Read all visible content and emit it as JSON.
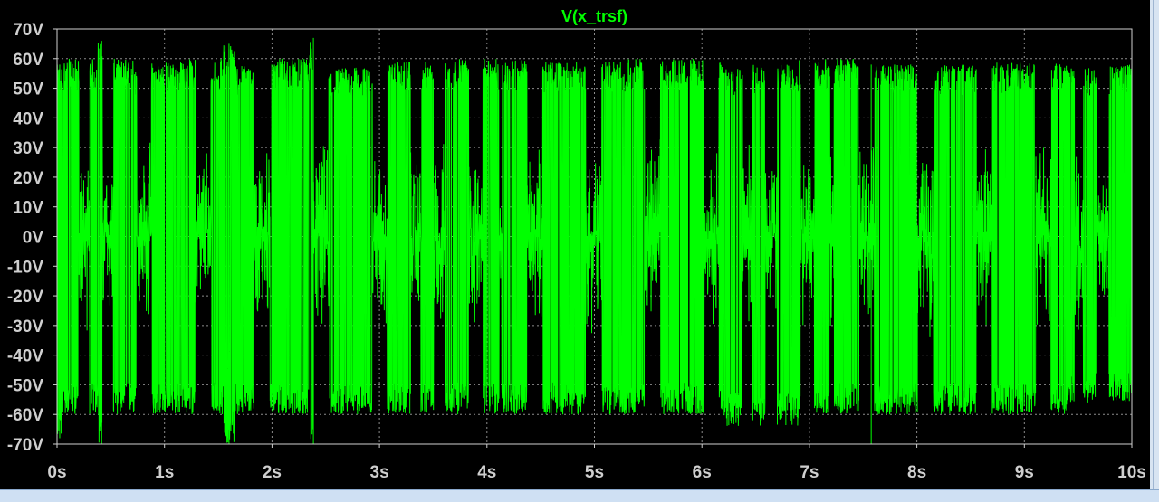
{
  "window": {
    "background": "#000000",
    "frame_color": "#d8e4f2"
  },
  "chart_data": {
    "type": "line",
    "title": "V(x_trsf)",
    "xlabel": "",
    "ylabel": "",
    "xlim": [
      0,
      10
    ],
    "ylim": [
      -70,
      70
    ],
    "x_ticks": [
      0,
      1,
      2,
      3,
      4,
      5,
      6,
      7,
      8,
      9,
      10
    ],
    "x_tick_labels": [
      "0s",
      "1s",
      "2s",
      "3s",
      "4s",
      "5s",
      "6s",
      "7s",
      "8s",
      "9s",
      "10s"
    ],
    "y_ticks": [
      70,
      60,
      50,
      40,
      30,
      20,
      10,
      0,
      -10,
      -20,
      -30,
      -40,
      -50,
      -60,
      -70
    ],
    "y_tick_labels": [
      "70V",
      "60V",
      "50V",
      "40V",
      "30V",
      "20V",
      "10V",
      "0V",
      "-10V",
      "-20V",
      "-30V",
      "-40V",
      "-50V",
      "-60V",
      "-70V"
    ],
    "grid": true,
    "series": [
      {
        "name": "V(x_trsf)",
        "color": "#00ff00",
        "description_segments": [
          {
            "x": [
              0.0,
              0.05
            ],
            "min": -68,
            "max": 58
          },
          {
            "x": [
              0.05,
              0.38
            ],
            "min": -60,
            "max": 60
          },
          {
            "x": [
              0.38,
              0.45
            ],
            "min": -70,
            "max": 66
          },
          {
            "x": [
              0.45,
              0.72
            ],
            "min": -60,
            "max": 60
          },
          {
            "x": [
              0.72,
              0.82
            ],
            "min": -58,
            "max": 57
          },
          {
            "x": [
              0.82,
              1.22
            ],
            "min": -60,
            "max": 59
          },
          {
            "x": [
              1.22,
              1.55
            ],
            "min": -60,
            "max": 60
          },
          {
            "x": [
              1.55,
              1.65
            ],
            "min": -70,
            "max": 65
          },
          {
            "x": [
              1.65,
              2.05
            ],
            "min": -60,
            "max": 58
          },
          {
            "x": [
              2.05,
              2.35
            ],
            "min": -60,
            "max": 60
          },
          {
            "x": [
              2.35,
              2.42
            ],
            "min": -70,
            "max": 67
          },
          {
            "x": [
              2.42,
              3.05
            ],
            "min": -60,
            "max": 57
          },
          {
            "x": [
              3.05,
              3.6
            ],
            "min": -60,
            "max": 59
          },
          {
            "x": [
              3.6,
              4.4
            ],
            "min": -60,
            "max": 60
          },
          {
            "x": [
              4.4,
              5.3
            ],
            "min": -60,
            "max": 59
          },
          {
            "x": [
              5.3,
              6.2
            ],
            "min": -60,
            "max": 60
          },
          {
            "x": [
              6.2,
              6.9
            ],
            "min": -64,
            "max": 58
          },
          {
            "x": [
              6.9,
              7.55
            ],
            "min": -60,
            "max": 60
          },
          {
            "x": [
              7.55,
              7.6
            ],
            "min": -70,
            "max": 58
          },
          {
            "x": [
              7.6,
              8.6
            ],
            "min": -60,
            "max": 58
          },
          {
            "x": [
              8.6,
              9.4
            ],
            "min": -60,
            "max": 59
          },
          {
            "x": [
              9.4,
              10.0
            ],
            "min": -56,
            "max": 58
          }
        ]
      }
    ]
  }
}
